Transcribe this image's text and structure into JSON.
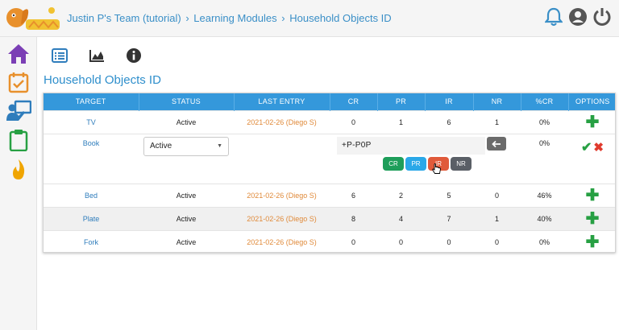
{
  "header": {
    "breadcrumb": [
      "Justin P's Team (tutorial)",
      "Learning Modules",
      "Household Objects ID"
    ],
    "separator": "›"
  },
  "page_title": "Household Objects ID",
  "table": {
    "columns": [
      "TARGET",
      "STATUS",
      "LAST ENTRY",
      "CR",
      "PR",
      "IR",
      "NR",
      "%CR",
      "OPTIONS"
    ],
    "rows": [
      {
        "target": "TV",
        "status": "Active",
        "last_entry": "2021-02-26 (Diego S)",
        "cr": "0",
        "pr": "1",
        "ir": "6",
        "nr": "1",
        "pct_cr": "0%"
      },
      {
        "target": "Book",
        "status": "",
        "last_entry": "",
        "cr": "",
        "pr": "",
        "ir": "",
        "nr": "",
        "pct_cr": "0%"
      },
      {
        "target": "Bed",
        "status": "Active",
        "last_entry": "2021-02-26 (Diego S)",
        "cr": "6",
        "pr": "2",
        "ir": "5",
        "nr": "0",
        "pct_cr": "46%"
      },
      {
        "target": "Plate",
        "status": "Active",
        "last_entry": "2021-02-26 (Diego S)",
        "cr": "8",
        "pr": "4",
        "ir": "7",
        "nr": "1",
        "pct_cr": "40%"
      },
      {
        "target": "Fork",
        "status": "Active",
        "last_entry": "2021-02-26 (Diego S)",
        "cr": "0",
        "pr": "0",
        "ir": "0",
        "nr": "0",
        "pct_cr": "0%"
      }
    ]
  },
  "editing": {
    "status_value": "Active",
    "entry_value": "+P-P0P",
    "prompt_buttons": [
      "CR",
      "PR",
      "IR",
      "NR"
    ]
  },
  "icons": {
    "top": [
      "bell-icon",
      "user-icon",
      "power-icon"
    ],
    "sidebar": [
      "home-icon",
      "calendar-check-icon",
      "teacher-icon",
      "clipboard-icon",
      "fire-icon"
    ],
    "toolbar": [
      "list-icon",
      "chart-icon",
      "info-icon"
    ]
  },
  "colors": {
    "accent": "#3498db",
    "title": "#2f8fcc",
    "last_entry": "#e08a3a",
    "plus": "#27a043",
    "sidebar_icon": "#7b3fb5"
  }
}
